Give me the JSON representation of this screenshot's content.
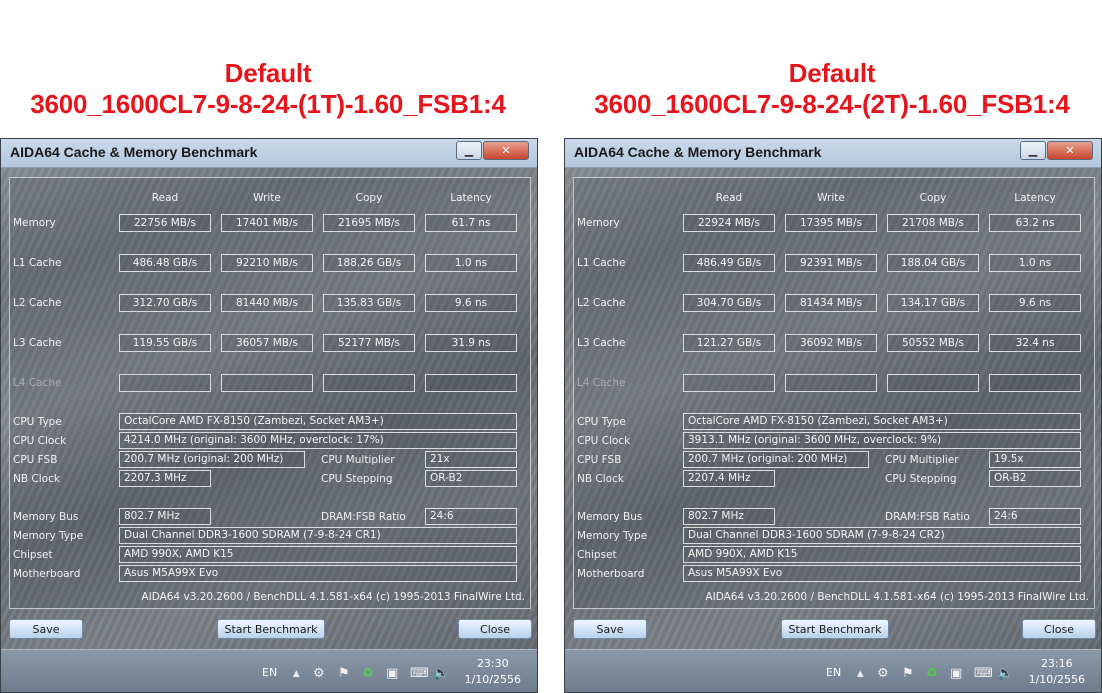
{
  "left": {
    "heading": [
      "Default",
      "3600_1600CL7-9-8-24-(1T)-1.60_FSB1:4"
    ],
    "title": "AIDA64 Cache & Memory Benchmark",
    "columns": [
      "Read",
      "Write",
      "Copy",
      "Latency"
    ],
    "rows": [
      {
        "label": "Memory",
        "values": [
          "22756 MB/s",
          "17401 MB/s",
          "21695 MB/s",
          "61.7 ns"
        ]
      },
      {
        "label": "L1 Cache",
        "values": [
          "486.48 GB/s",
          "92210 MB/s",
          "188.26 GB/s",
          "1.0 ns"
        ]
      },
      {
        "label": "L2 Cache",
        "values": [
          "312.70 GB/s",
          "81440 MB/s",
          "135.83 GB/s",
          "9.6 ns"
        ]
      },
      {
        "label": "L3 Cache",
        "values": [
          "119.55 GB/s",
          "36057 MB/s",
          "52177 MB/s",
          "31.9 ns"
        ]
      },
      {
        "label": "L4 Cache",
        "values": [
          "",
          "",
          "",
          ""
        ]
      }
    ],
    "info": {
      "cpu_type_label": "CPU Type",
      "cpu_type": "OctalCore AMD FX-8150  (Zambezi, Socket AM3+)",
      "cpu_clock_label": "CPU Clock",
      "cpu_clock": "4214.0 MHz  (original: 3600 MHz, overclock: 17%)",
      "cpu_fsb_label": "CPU FSB",
      "cpu_fsb": "200.7 MHz  (original: 200 MHz)",
      "cpu_mult_label": "CPU Multiplier",
      "cpu_mult": "21x",
      "nb_clock_label": "NB Clock",
      "nb_clock": "2207.3 MHz",
      "cpu_stepping_label": "CPU Stepping",
      "cpu_stepping": "OR-B2",
      "mem_bus_label": "Memory Bus",
      "mem_bus": "802.7 MHz",
      "dram_fsb_label": "DRAM:FSB Ratio",
      "dram_fsb": "24:6",
      "mem_type_label": "Memory Type",
      "mem_type": "Dual Channel DDR3-1600 SDRAM  (7-9-8-24 CR1)",
      "chipset_label": "Chipset",
      "chipset": "AMD 990X, AMD K15",
      "motherboard_label": "Motherboard",
      "motherboard": "Asus M5A99X Evo"
    },
    "footer": "AIDA64 v3.20.2600 / BenchDLL 4.1.581-x64  (c) 1995-2013 FinalWire Ltd.",
    "buttons": {
      "save": "Save",
      "start": "Start Benchmark",
      "close": "Close"
    },
    "taskbar": {
      "lang": "EN",
      "time": "23:30",
      "date": "1/10/2556"
    }
  },
  "right": {
    "heading": [
      "Default",
      "3600_1600CL7-9-8-24-(2T)-1.60_FSB1:4"
    ],
    "title": "AIDA64 Cache & Memory Benchmark",
    "columns": [
      "Read",
      "Write",
      "Copy",
      "Latency"
    ],
    "rows": [
      {
        "label": "Memory",
        "values": [
          "22924 MB/s",
          "17395 MB/s",
          "21708 MB/s",
          "63.2 ns"
        ]
      },
      {
        "label": "L1 Cache",
        "values": [
          "486.49 GB/s",
          "92391 MB/s",
          "188.04 GB/s",
          "1.0 ns"
        ]
      },
      {
        "label": "L2 Cache",
        "values": [
          "304.70 GB/s",
          "81434 MB/s",
          "134.17 GB/s",
          "9.6 ns"
        ]
      },
      {
        "label": "L3 Cache",
        "values": [
          "121.27 GB/s",
          "36092 MB/s",
          "50552 MB/s",
          "32.4 ns"
        ]
      },
      {
        "label": "L4 Cache",
        "values": [
          "",
          "",
          "",
          ""
        ]
      }
    ],
    "info": {
      "cpu_type_label": "CPU Type",
      "cpu_type": "OctalCore AMD FX-8150  (Zambezi, Socket AM3+)",
      "cpu_clock_label": "CPU Clock",
      "cpu_clock": "3913.1 MHz  (original: 3600 MHz, overclock: 9%)",
      "cpu_fsb_label": "CPU FSB",
      "cpu_fsb": "200.7 MHz  (original: 200 MHz)",
      "cpu_mult_label": "CPU Multiplier",
      "cpu_mult": "19.5x",
      "nb_clock_label": "NB Clock",
      "nb_clock": "2207.4 MHz",
      "cpu_stepping_label": "CPU Stepping",
      "cpu_stepping": "OR-B2",
      "mem_bus_label": "Memory Bus",
      "mem_bus": "802.7 MHz",
      "dram_fsb_label": "DRAM:FSB Ratio",
      "dram_fsb": "24:6",
      "mem_type_label": "Memory Type",
      "mem_type": "Dual Channel DDR3-1600 SDRAM  (7-9-8-24 CR2)",
      "chipset_label": "Chipset",
      "chipset": "AMD 990X, AMD K15",
      "motherboard_label": "Motherboard",
      "motherboard": "Asus M5A99X Evo"
    },
    "footer": "AIDA64 v3.20.2600 / BenchDLL 4.1.581-x64  (c) 1995-2013 FinalWire Ltd.",
    "buttons": {
      "save": "Save",
      "start": "Start Benchmark",
      "close": "Close"
    },
    "taskbar": {
      "lang": "EN",
      "time": "23:16",
      "date": "1/10/2556"
    }
  },
  "colors": {
    "heading": "#e8141b",
    "titlebar": "#c9d9ea",
    "panel": "#757b81"
  },
  "icons": [
    "minimize-icon",
    "close-icon",
    "tray-arrow-icon",
    "network-icon",
    "flag-icon",
    "update-icon",
    "monitor-icon",
    "keyboard-icon",
    "speaker-icon"
  ]
}
